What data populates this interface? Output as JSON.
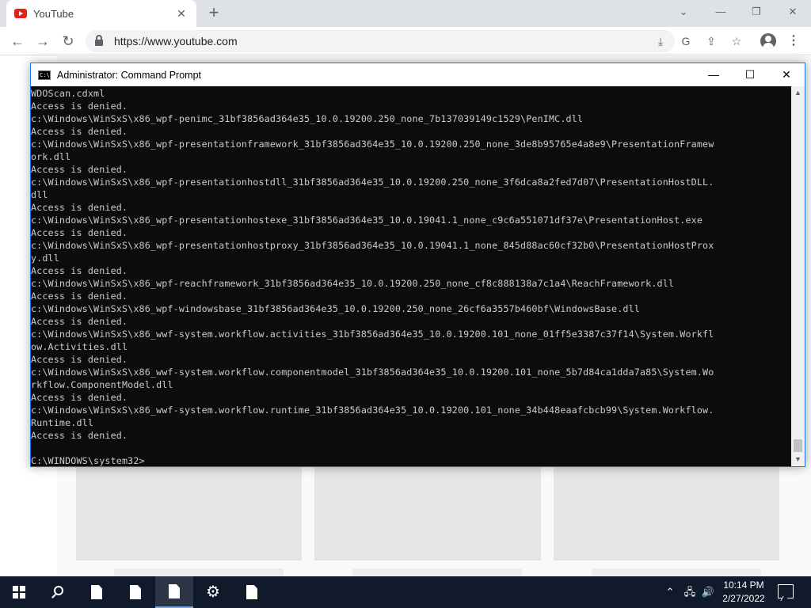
{
  "browser": {
    "tab_title": "YouTube",
    "tab_close": "✕",
    "new_tab": "+",
    "url": "https://www.youtube.com",
    "window_controls": {
      "dropdown": "⌄",
      "minimize": "—",
      "restore": "❐",
      "close": "✕"
    },
    "nav": {
      "back": "←",
      "forward": "→",
      "reload": "↻"
    }
  },
  "cmd": {
    "title": "Administrator: Command Prompt",
    "icon_text": "C:\\",
    "controls": {
      "minimize": "—",
      "maximize": "☐",
      "close": "✕"
    },
    "lines": [
      "WDOScan.cdxml",
      "Access is denied.",
      "c:\\Windows\\WinSxS\\x86_wpf-penimc_31bf3856ad364e35_10.0.19200.250_none_7b137039149c1529\\PenIMC.dll",
      "Access is denied.",
      "c:\\Windows\\WinSxS\\x86_wpf-presentationframework_31bf3856ad364e35_10.0.19200.250_none_3de8b95765e4a8e9\\PresentationFramew",
      "ork.dll",
      "Access is denied.",
      "c:\\Windows\\WinSxS\\x86_wpf-presentationhostdll_31bf3856ad364e35_10.0.19200.250_none_3f6dca8a2fed7d07\\PresentationHostDLL.",
      "dll",
      "Access is denied.",
      "c:\\Windows\\WinSxS\\x86_wpf-presentationhostexe_31bf3856ad364e35_10.0.19041.1_none_c9c6a551071df37e\\PresentationHost.exe",
      "Access is denied.",
      "c:\\Windows\\WinSxS\\x86_wpf-presentationhostproxy_31bf3856ad364e35_10.0.19041.1_none_845d88ac60cf32b0\\PresentationHostProx",
      "y.dll",
      "Access is denied.",
      "c:\\Windows\\WinSxS\\x86_wpf-reachframework_31bf3856ad364e35_10.0.19200.250_none_cf8c888138a7c1a4\\ReachFramework.dll",
      "Access is denied.",
      "c:\\Windows\\WinSxS\\x86_wpf-windowsbase_31bf3856ad364e35_10.0.19200.250_none_26cf6a3557b460bf\\WindowsBase.dll",
      "Access is denied.",
      "c:\\Windows\\WinSxS\\x86_wwf-system.workflow.activities_31bf3856ad364e35_10.0.19200.101_none_01ff5e3387c37f14\\System.Workfl",
      "ow.Activities.dll",
      "Access is denied.",
      "c:\\Windows\\WinSxS\\x86_wwf-system.workflow.componentmodel_31bf3856ad364e35_10.0.19200.101_none_5b7d84ca1dda7a85\\System.Wo",
      "rkflow.ComponentModel.dll",
      "Access is denied.",
      "c:\\Windows\\WinSxS\\x86_wwf-system.workflow.runtime_31bf3856ad364e35_10.0.19200.101_none_34b448eaafcbcb99\\System.Workflow.",
      "Runtime.dll",
      "Access is denied.",
      "",
      "C:\\WINDOWS\\system32>"
    ],
    "scroll_up": "▲",
    "scroll_down": "▼"
  },
  "taskbar": {
    "time": "10:14 PM",
    "date": "2/27/2022",
    "tray": {
      "chevron": "⌃",
      "network": "🖧",
      "volume": "🔊"
    }
  }
}
